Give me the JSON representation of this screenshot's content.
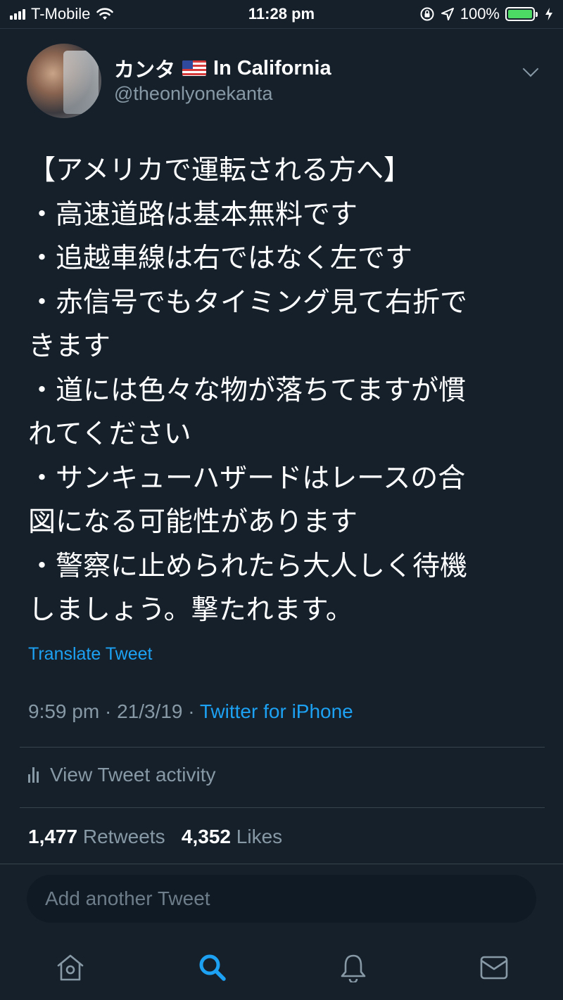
{
  "status_bar": {
    "carrier": "T-Mobile",
    "time": "11:28 pm",
    "battery_percent": "100%",
    "battery_level": 1.0
  },
  "tweet": {
    "display_name": "カンタ",
    "location": "In California",
    "handle": "@theonlyonekanta",
    "text_lines": [
      "【アメリカで運転される方へ】",
      "・高速道路は基本無料です",
      "・追越車線は右ではなく左です",
      "・赤信号でもタイミング見て右折で",
      "きます",
      "・道には色々な物が落ちてますが慣",
      "れてください",
      "・サンキューハザードはレースの合",
      "図になる可能性があります",
      "・警察に止められたら大人しく待機",
      "しましょう。撃たれます。"
    ],
    "translate_label": "Translate Tweet",
    "time": "9:59 pm",
    "date": "21/3/19",
    "separator": "·",
    "source": "Twitter for iPhone"
  },
  "activity": {
    "label": "View Tweet activity"
  },
  "stats": {
    "retweets_count": "1,477",
    "retweets_label": "Retweets",
    "likes_count": "4,352",
    "likes_label": "Likes"
  },
  "reply": {
    "placeholder": "Add another Tweet"
  },
  "tab_bar": {
    "items": [
      "home-icon",
      "search-icon",
      "notifications-icon",
      "messages-icon"
    ],
    "active": "search-icon"
  },
  "colors": {
    "background": "#15202b",
    "accent": "#1da1f2",
    "secondary_text": "#8899a6",
    "battery": "#4cd964"
  }
}
